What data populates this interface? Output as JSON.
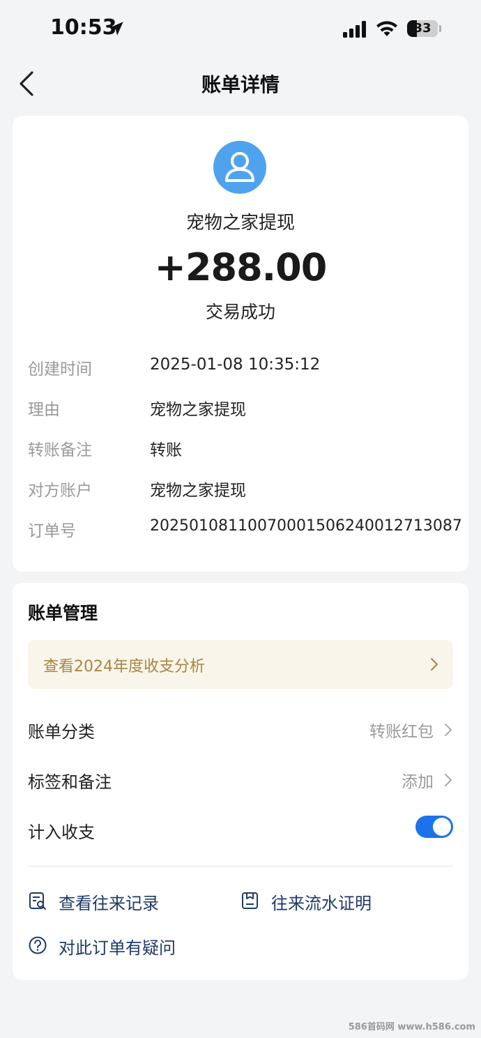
{
  "status_bar": {
    "time": "10:53",
    "battery": "33"
  },
  "nav": {
    "title": "账单详情"
  },
  "transaction": {
    "merchant": "宠物之家提现",
    "amount": "+288.00",
    "status": "交易成功",
    "details": [
      {
        "label": "创建时间",
        "value": "2025-01-08 10:35:12"
      },
      {
        "label": "理由",
        "value": "宠物之家提现"
      },
      {
        "label": "转账备注",
        "value": "转账"
      },
      {
        "label": "对方账户",
        "value": "宠物之家提现"
      },
      {
        "label": "订单号",
        "value": "20250108110070001506240012713087"
      }
    ]
  },
  "manage": {
    "title": "账单管理",
    "annual_link": "查看2024年度收支分析",
    "category_label": "账单分类",
    "category_value": "转账红包",
    "tags_label": "标签和备注",
    "tags_value": "添加",
    "count_label": "计入收支",
    "count_enabled": true,
    "actions": {
      "history": "查看往来记录",
      "proof": "往来流水证明",
      "question": "对此订单有疑问"
    }
  },
  "watermark": "586首码网 www.h586.com",
  "colors": {
    "accent": "#1c72ea",
    "avatar": "#4fa3ee",
    "banner_text": "#a68642",
    "action_text": "#1f3a66"
  }
}
